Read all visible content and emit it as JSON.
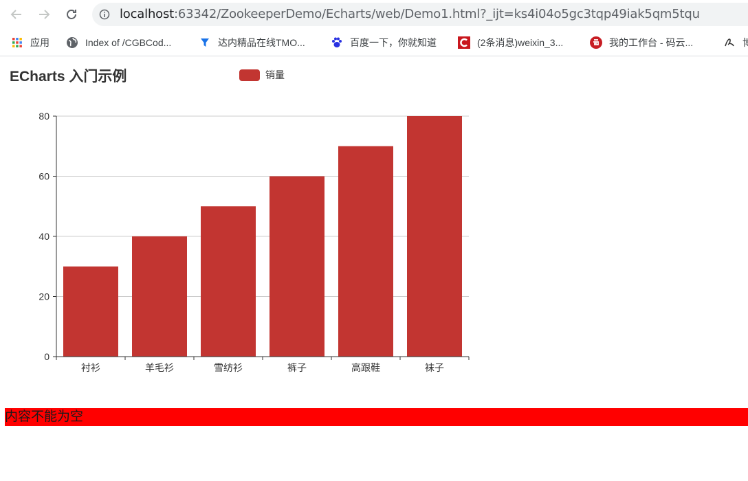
{
  "browser": {
    "url_host": "localhost",
    "url_path": ":63342/ZookeeperDemo/Echarts/web/Demo1.html?_ijt=ks4i04o5gc3tqp49iak5qm5tqu",
    "bookmarks": [
      {
        "label": "应用",
        "icon": "apps-grid-icon"
      },
      {
        "label": "Index of /CGBCod...",
        "icon": "globe-icon"
      },
      {
        "label": "达内精品在线TMO...",
        "icon": "funnel-icon"
      },
      {
        "label": "百度一下，你就知道",
        "icon": "baidu-paw-icon"
      },
      {
        "label": "(2条消息)weixin_3...",
        "icon": "csdn-c-icon"
      },
      {
        "label": "我的工作台 - 码云...",
        "icon": "gitee-icon"
      },
      {
        "label": "博",
        "icon": "bookmark-script-icon"
      }
    ]
  },
  "page": {
    "title": "ECharts 入门示例",
    "error_message": "内容不能为空"
  },
  "colors": {
    "bar": "#c23531",
    "error_bg": "#ff0000"
  },
  "chart_data": {
    "type": "bar",
    "categories": [
      "衬衫",
      "羊毛衫",
      "雪纺衫",
      "裤子",
      "高跟鞋",
      "袜子"
    ],
    "series": [
      {
        "name": "销量",
        "values": [
          30,
          40,
          50,
          60,
          70,
          80
        ]
      }
    ],
    "ylim": [
      0,
      80
    ],
    "yticks": [
      0,
      20,
      40,
      60,
      80
    ],
    "grid": true,
    "legend_position": "top-center"
  }
}
